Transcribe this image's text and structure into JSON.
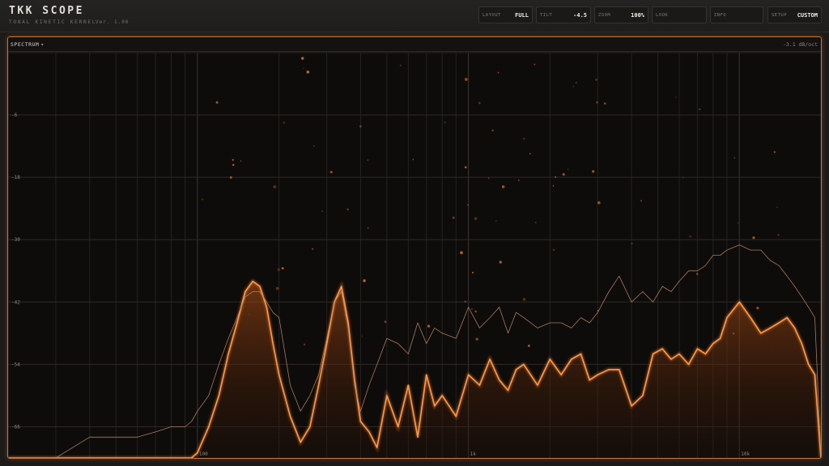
{
  "app": {
    "title": "TKK SCOPE",
    "subtitle": "TONAL KINETIC KERNEL",
    "version": "Ver. 1.00"
  },
  "controls": [
    {
      "label": "LAYOUT",
      "value": "FULL"
    },
    {
      "label": "TILT",
      "value": "-4.5"
    },
    {
      "label": "ZOOM",
      "value": "100%"
    },
    {
      "label": "LOOK",
      "value": ""
    },
    {
      "label": "INFO",
      "value": ""
    },
    {
      "label": "SETUP",
      "value": "CUSTOM"
    }
  ],
  "panel": {
    "view_label": "SPECTRUM",
    "slope_readout": "-3.1 dB/oct",
    "accent_color": "#f07a28"
  },
  "icons": {
    "view_dropdown": "chevron-down-icon"
  },
  "chart_data": {
    "type": "line",
    "x_scale": "log",
    "xlim": [
      20,
      20000
    ],
    "ylim": [
      -72,
      6
    ],
    "grid": true,
    "x_tick_labels": [
      {
        "x": 100,
        "label": "100"
      },
      {
        "x": 1000,
        "label": "1k"
      },
      {
        "x": 10000,
        "label": "10k"
      }
    ],
    "y_tick_labels": [
      -6,
      -18,
      -30,
      -42,
      -54,
      -66
    ],
    "series": [
      {
        "style": "filled-glow",
        "x": [
          20,
          25,
          30,
          40,
          50,
          60,
          70,
          80,
          90,
          95,
          100,
          110,
          120,
          130,
          140,
          150,
          160,
          170,
          180,
          190,
          200,
          220,
          240,
          260,
          280,
          300,
          320,
          340,
          360,
          380,
          400,
          430,
          460,
          500,
          550,
          600,
          650,
          700,
          750,
          800,
          900,
          1000,
          1100,
          1200,
          1300,
          1400,
          1500,
          1600,
          1800,
          2000,
          2200,
          2400,
          2600,
          2800,
          3000,
          3300,
          3600,
          4000,
          4400,
          4800,
          5200,
          5600,
          6000,
          6500,
          7000,
          7500,
          8000,
          8500,
          9000,
          10000,
          11000,
          12000,
          13000,
          14000,
          15000,
          16000,
          17000,
          18000,
          19000,
          20000
        ],
        "y": [
          -72,
          -72,
          -72,
          -72,
          -72,
          -72,
          -72,
          -72,
          -72,
          -72,
          -71,
          -66,
          -60,
          -52,
          -46,
          -40,
          -38,
          -39,
          -43,
          -50,
          -56,
          -64,
          -69,
          -66,
          -58,
          -50,
          -42,
          -39,
          -46,
          -57,
          -65,
          -67,
          -70,
          -60,
          -66,
          -58,
          -68,
          -56,
          -62,
          -60,
          -64,
          -56,
          -58,
          -53,
          -57,
          -59,
          -55,
          -54,
          -58,
          -53,
          -56,
          -53,
          -52,
          -57,
          -56,
          -55,
          -55,
          -62,
          -60,
          -52,
          -51,
          -53,
          -52,
          -54,
          -51,
          -52,
          -50,
          -49,
          -45,
          -42,
          -45,
          -48,
          -47,
          -46,
          -45,
          -47,
          -50,
          -54,
          -56,
          -72
        ]
      },
      {
        "style": "thin-line",
        "x": [
          20,
          25,
          30,
          40,
          50,
          60,
          70,
          80,
          90,
          95,
          100,
          110,
          120,
          130,
          140,
          150,
          160,
          170,
          180,
          190,
          200,
          220,
          240,
          260,
          280,
          300,
          320,
          340,
          360,
          380,
          400,
          430,
          460,
          500,
          550,
          600,
          650,
          700,
          750,
          800,
          900,
          1000,
          1100,
          1200,
          1300,
          1400,
          1500,
          1600,
          1800,
          2000,
          2200,
          2400,
          2600,
          2800,
          3000,
          3300,
          3600,
          4000,
          4400,
          4800,
          5200,
          5600,
          6000,
          6500,
          7000,
          7500,
          8000,
          8500,
          9000,
          10000,
          11000,
          12000,
          13000,
          14000,
          15000,
          16000,
          17000,
          18000,
          19000,
          20000
        ],
        "y": [
          -72,
          -72,
          -72,
          -68,
          -68,
          -68,
          -67,
          -66,
          -66,
          -65,
          -63,
          -60,
          -54,
          -49,
          -45,
          -41,
          -40,
          -40,
          -42,
          -44,
          -45,
          -58,
          -63,
          -60,
          -56,
          -49,
          -42,
          -40,
          -47,
          -58,
          -63,
          -58,
          -54,
          -49,
          -50,
          -52,
          -46,
          -50,
          -47,
          -48,
          -49,
          -43,
          -47,
          -45,
          -43,
          -48,
          -44,
          -45,
          -47,
          -46,
          -46,
          -47,
          -45,
          -46,
          -44,
          -40,
          -37,
          -42,
          -40,
          -42,
          -39,
          -40,
          -38,
          -36,
          -36,
          -35,
          -33,
          -33,
          -32,
          -31,
          -32,
          -32,
          -34,
          -35,
          -37,
          -39,
          -41,
          -43,
          -45,
          -72
        ]
      }
    ]
  }
}
